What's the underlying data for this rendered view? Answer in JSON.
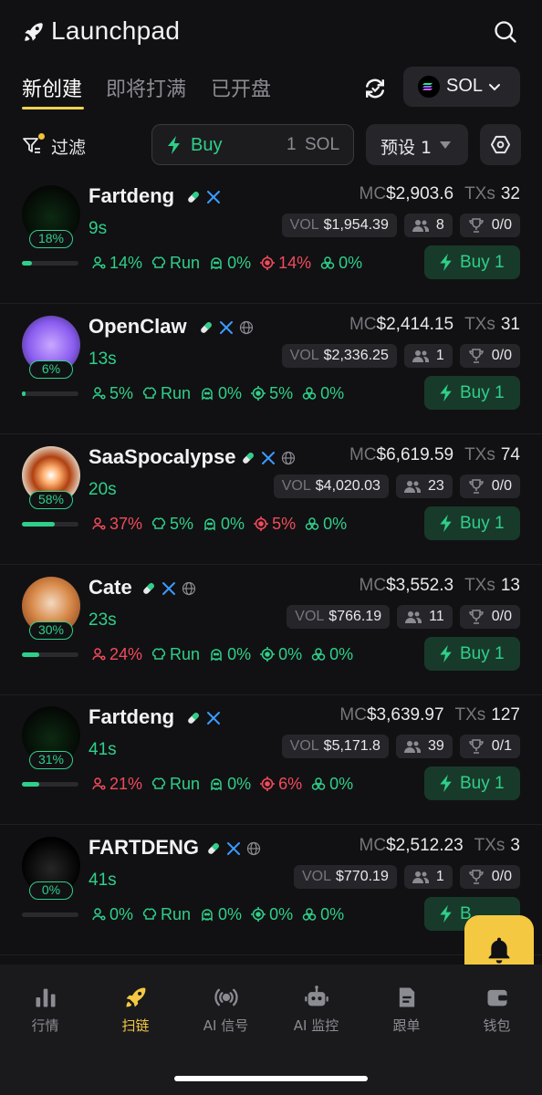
{
  "header": {
    "title": "Launchpad"
  },
  "tabs": [
    {
      "label": "新创建"
    },
    {
      "label": "即将打满"
    },
    {
      "label": "已开盘"
    }
  ],
  "chain": {
    "label": "SOL"
  },
  "filter": {
    "label": "过滤"
  },
  "quick_buy": {
    "label": "Buy",
    "amount": "1",
    "unit": "SOL"
  },
  "preset": {
    "label": "预设 1"
  },
  "rows": [
    {
      "name": "Fartdeng",
      "age": "9s",
      "pct": "18%",
      "progress": 0.18,
      "mc_label": "MC",
      "mc": "$2,903.6",
      "txs_label": "TXs",
      "txs": "32",
      "vol_label": "VOL",
      "vol": "$1,954.39",
      "holders": "8",
      "trophy": "0/0",
      "stats": [
        "14%",
        "Run",
        "0%",
        "14%",
        "0%"
      ],
      "buy": "Buy 1"
    },
    {
      "name": "OpenClaw",
      "age": "13s",
      "pct": "6%",
      "progress": 0.06,
      "mc_label": "MC",
      "mc": "$2,414.15",
      "txs_label": "TXs",
      "txs": "31",
      "vol_label": "VOL",
      "vol": "$2,336.25",
      "holders": "1",
      "trophy": "0/0",
      "stats": [
        "5%",
        "Run",
        "0%",
        "5%",
        "0%"
      ],
      "buy": "Buy 1"
    },
    {
      "name": "SaaSpocalypse",
      "age": "20s",
      "pct": "58%",
      "progress": 0.58,
      "mc_label": "MC",
      "mc": "$6,619.59",
      "txs_label": "TXs",
      "txs": "74",
      "vol_label": "VOL",
      "vol": "$4,020.03",
      "holders": "23",
      "trophy": "0/0",
      "stats": [
        "37%",
        "5%",
        "0%",
        "5%",
        "0%"
      ],
      "buy": "Buy 1"
    },
    {
      "name": "Cate",
      "age": "23s",
      "pct": "30%",
      "progress": 0.3,
      "mc_label": "MC",
      "mc": "$3,552.3",
      "txs_label": "TXs",
      "txs": "13",
      "vol_label": "VOL",
      "vol": "$766.19",
      "holders": "11",
      "trophy": "0/0",
      "stats": [
        "24%",
        "Run",
        "0%",
        "0%",
        "0%"
      ],
      "buy": "Buy 1"
    },
    {
      "name": "Fartdeng",
      "age": "41s",
      "pct": "31%",
      "progress": 0.31,
      "mc_label": "MC",
      "mc": "$3,639.97",
      "txs_label": "TXs",
      "txs": "127",
      "vol_label": "VOL",
      "vol": "$5,171.8",
      "holders": "39",
      "trophy": "0/1",
      "stats": [
        "21%",
        "Run",
        "0%",
        "6%",
        "0%"
      ],
      "buy": "Buy 1"
    },
    {
      "name": "FARTDENG",
      "age": "41s",
      "pct": "0%",
      "progress": 0.0,
      "mc_label": "MC",
      "mc": "$2,512.23",
      "txs_label": "TXs",
      "txs": "3",
      "vol_label": "VOL",
      "vol": "$770.19",
      "holders": "1",
      "trophy": "0/0",
      "stats": [
        "0%",
        "Run",
        "0%",
        "0%",
        "0%"
      ],
      "buy": "B"
    }
  ],
  "nav": [
    {
      "label": "行情"
    },
    {
      "label": "扫链"
    },
    {
      "label": "AI 信号"
    },
    {
      "label": "AI 监控"
    },
    {
      "label": "跟单"
    },
    {
      "label": "钱包"
    }
  ],
  "colors": {
    "green": "#2fcf8a",
    "red": "#f14b5b",
    "accent": "#f5c842",
    "background": "#111113"
  }
}
